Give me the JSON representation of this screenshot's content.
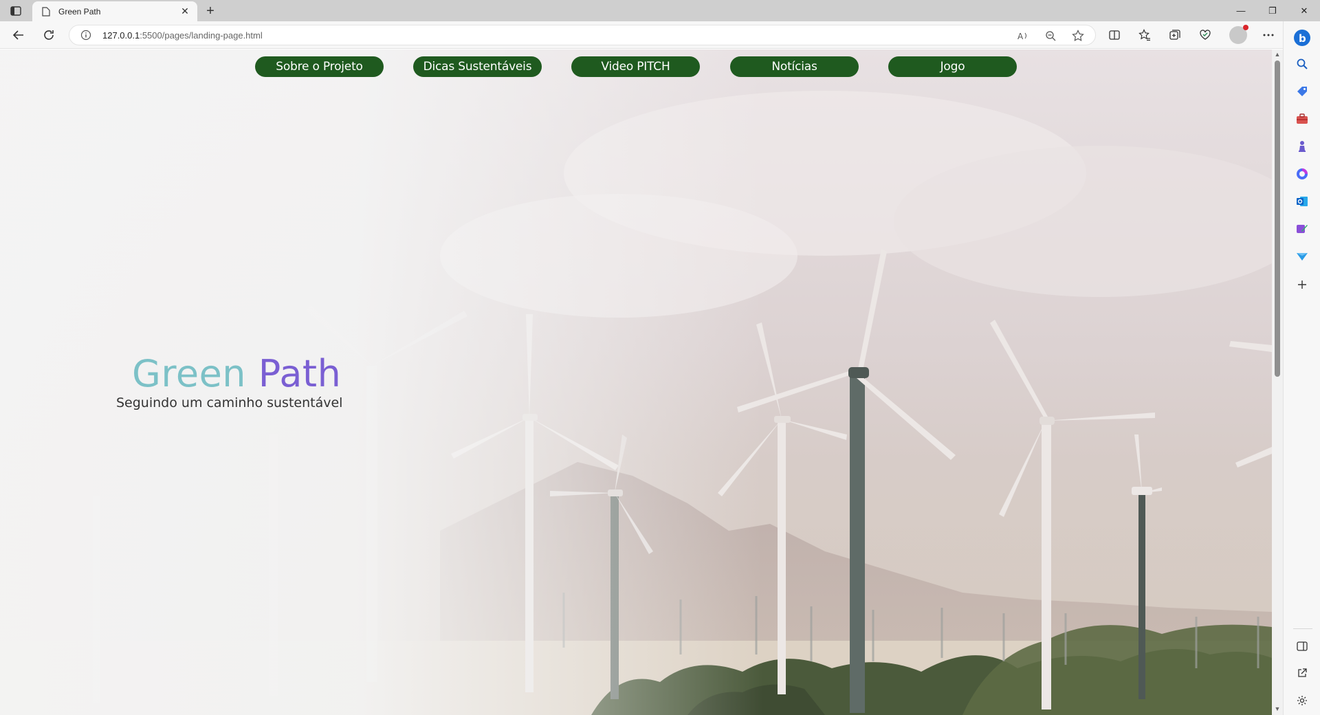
{
  "browser": {
    "tab": {
      "title": "Green Path"
    },
    "address": {
      "host": "127.0.0.1",
      "rest": ":5500/pages/landing-page.html"
    }
  },
  "nav": {
    "items": [
      {
        "label": "Sobre o Projeto"
      },
      {
        "label": "Dicas Sustentáveis"
      },
      {
        "label": "Video PITCH"
      },
      {
        "label": "Notícias"
      },
      {
        "label": "Jogo"
      }
    ]
  },
  "hero": {
    "title_part1": "Green",
    "title_part2": "Path",
    "subtitle": "Seguindo um caminho sustentável"
  },
  "colors": {
    "nav_button": "#1f5a1f",
    "title_green": "#7cc1c7",
    "title_purple": "#7a5fd3"
  }
}
